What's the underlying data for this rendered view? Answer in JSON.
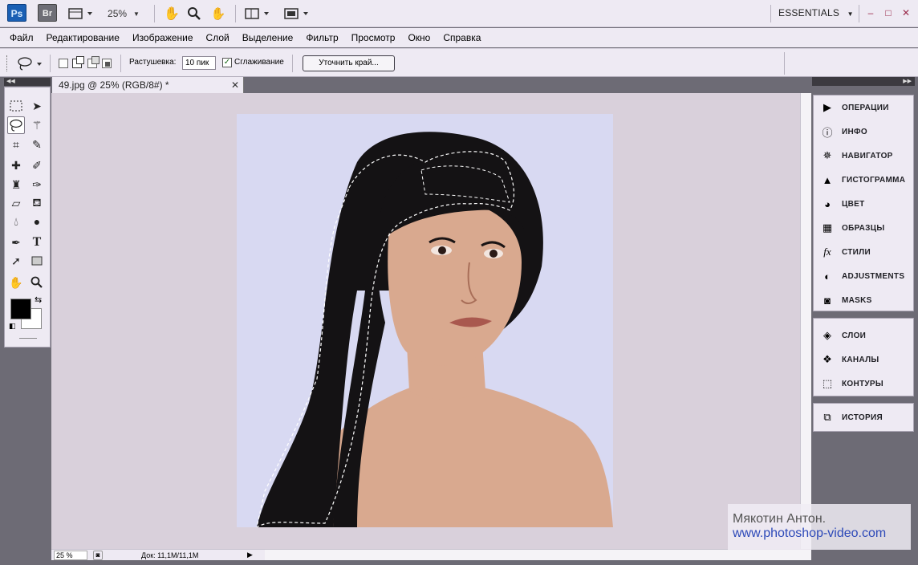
{
  "appbar": {
    "ps_logo": "Ps",
    "br_logo": "Br",
    "zoom": "25%",
    "workspace": "ESSENTIALS",
    "workspace_arrow": "▼",
    "minimize": "–",
    "maximize": "□",
    "close": "✕"
  },
  "menu": [
    "Файл",
    "Редактирование",
    "Изображение",
    "Слой",
    "Выделение",
    "Фильтр",
    "Просмотр",
    "Окно",
    "Справка"
  ],
  "options": {
    "feather_label": "Растушевка:",
    "feather_value": "10 пик",
    "antialias_label": "Сглаживание",
    "antialias_checked": true,
    "refine_edge": "Уточнить край..."
  },
  "document": {
    "tab_title": "49.jpg @ 25% (RGB/8#) *",
    "tab_close": "✕",
    "zoom": "25 %",
    "doc_size": "Док: 11,1M/11,1M"
  },
  "watermark": {
    "author": "Мякотин Антон.",
    "site": "www.photoshop-video.com"
  },
  "panels": {
    "group1": [
      {
        "label": "ОПЕРАЦИИ",
        "icon": "play-icon"
      },
      {
        "label": "ИНФО",
        "icon": "info-icon"
      },
      {
        "label": "НАВИГАТОР",
        "icon": "navigator-icon"
      },
      {
        "label": "ГИСТОГРАММА",
        "icon": "histogram-icon"
      },
      {
        "label": "ЦВЕТ",
        "icon": "color-palette-icon"
      },
      {
        "label": "ОБРАЗЦЫ",
        "icon": "swatches-icon"
      },
      {
        "label": "СТИЛИ",
        "icon": "styles-fx-icon"
      },
      {
        "label": "ADJUSTMENTS",
        "icon": "adjustments-icon"
      },
      {
        "label": "MASKS",
        "icon": "masks-icon"
      }
    ],
    "group2": [
      {
        "label": "СЛОИ",
        "icon": "layers-icon"
      },
      {
        "label": "КАНАЛЫ",
        "icon": "channels-icon"
      },
      {
        "label": "КОНТУРЫ",
        "icon": "paths-icon"
      }
    ],
    "group3": [
      {
        "label": "ИСТОРИЯ",
        "icon": "history-icon"
      }
    ]
  },
  "colors": {
    "foreground": "#000000",
    "background": "#ffffff",
    "photo_backdrop": "#d8d9f2",
    "hair": "#141214",
    "skin": "#d9a98f"
  }
}
